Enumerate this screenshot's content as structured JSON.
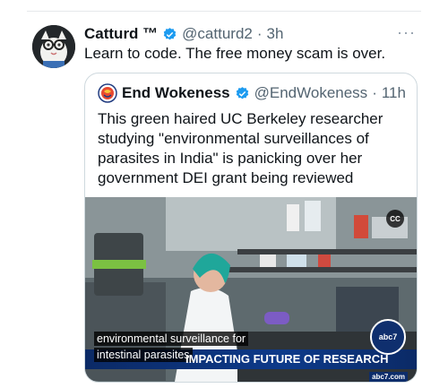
{
  "tweet": {
    "author_name": "Catturd ™",
    "handle": "@catturd2",
    "separator": "·",
    "time": "3h",
    "text": "Learn to code. The free money scam is over.",
    "more_icon": "more-icon"
  },
  "quote": {
    "author_name": "End Wokeness",
    "handle": "@EndWokeness",
    "separator": "·",
    "time": "11h",
    "text": "This green haired UC Berkeley researcher studying \"environmental surveillances of parasites in India\" is panicking over her government DEI grant being reviewed"
  },
  "video": {
    "caption_line1": "environmental surveillance for",
    "caption_line2": "intestinal parasites",
    "ticker_text": "IMPACTING FUTURE OF RESEARCH",
    "cc_label": "CC",
    "network_logo": "abc7",
    "network_url": "abc7.com"
  },
  "colors": {
    "verified_blue": "#1d9bf0",
    "muted": "#536471",
    "border": "#cfd9de"
  }
}
